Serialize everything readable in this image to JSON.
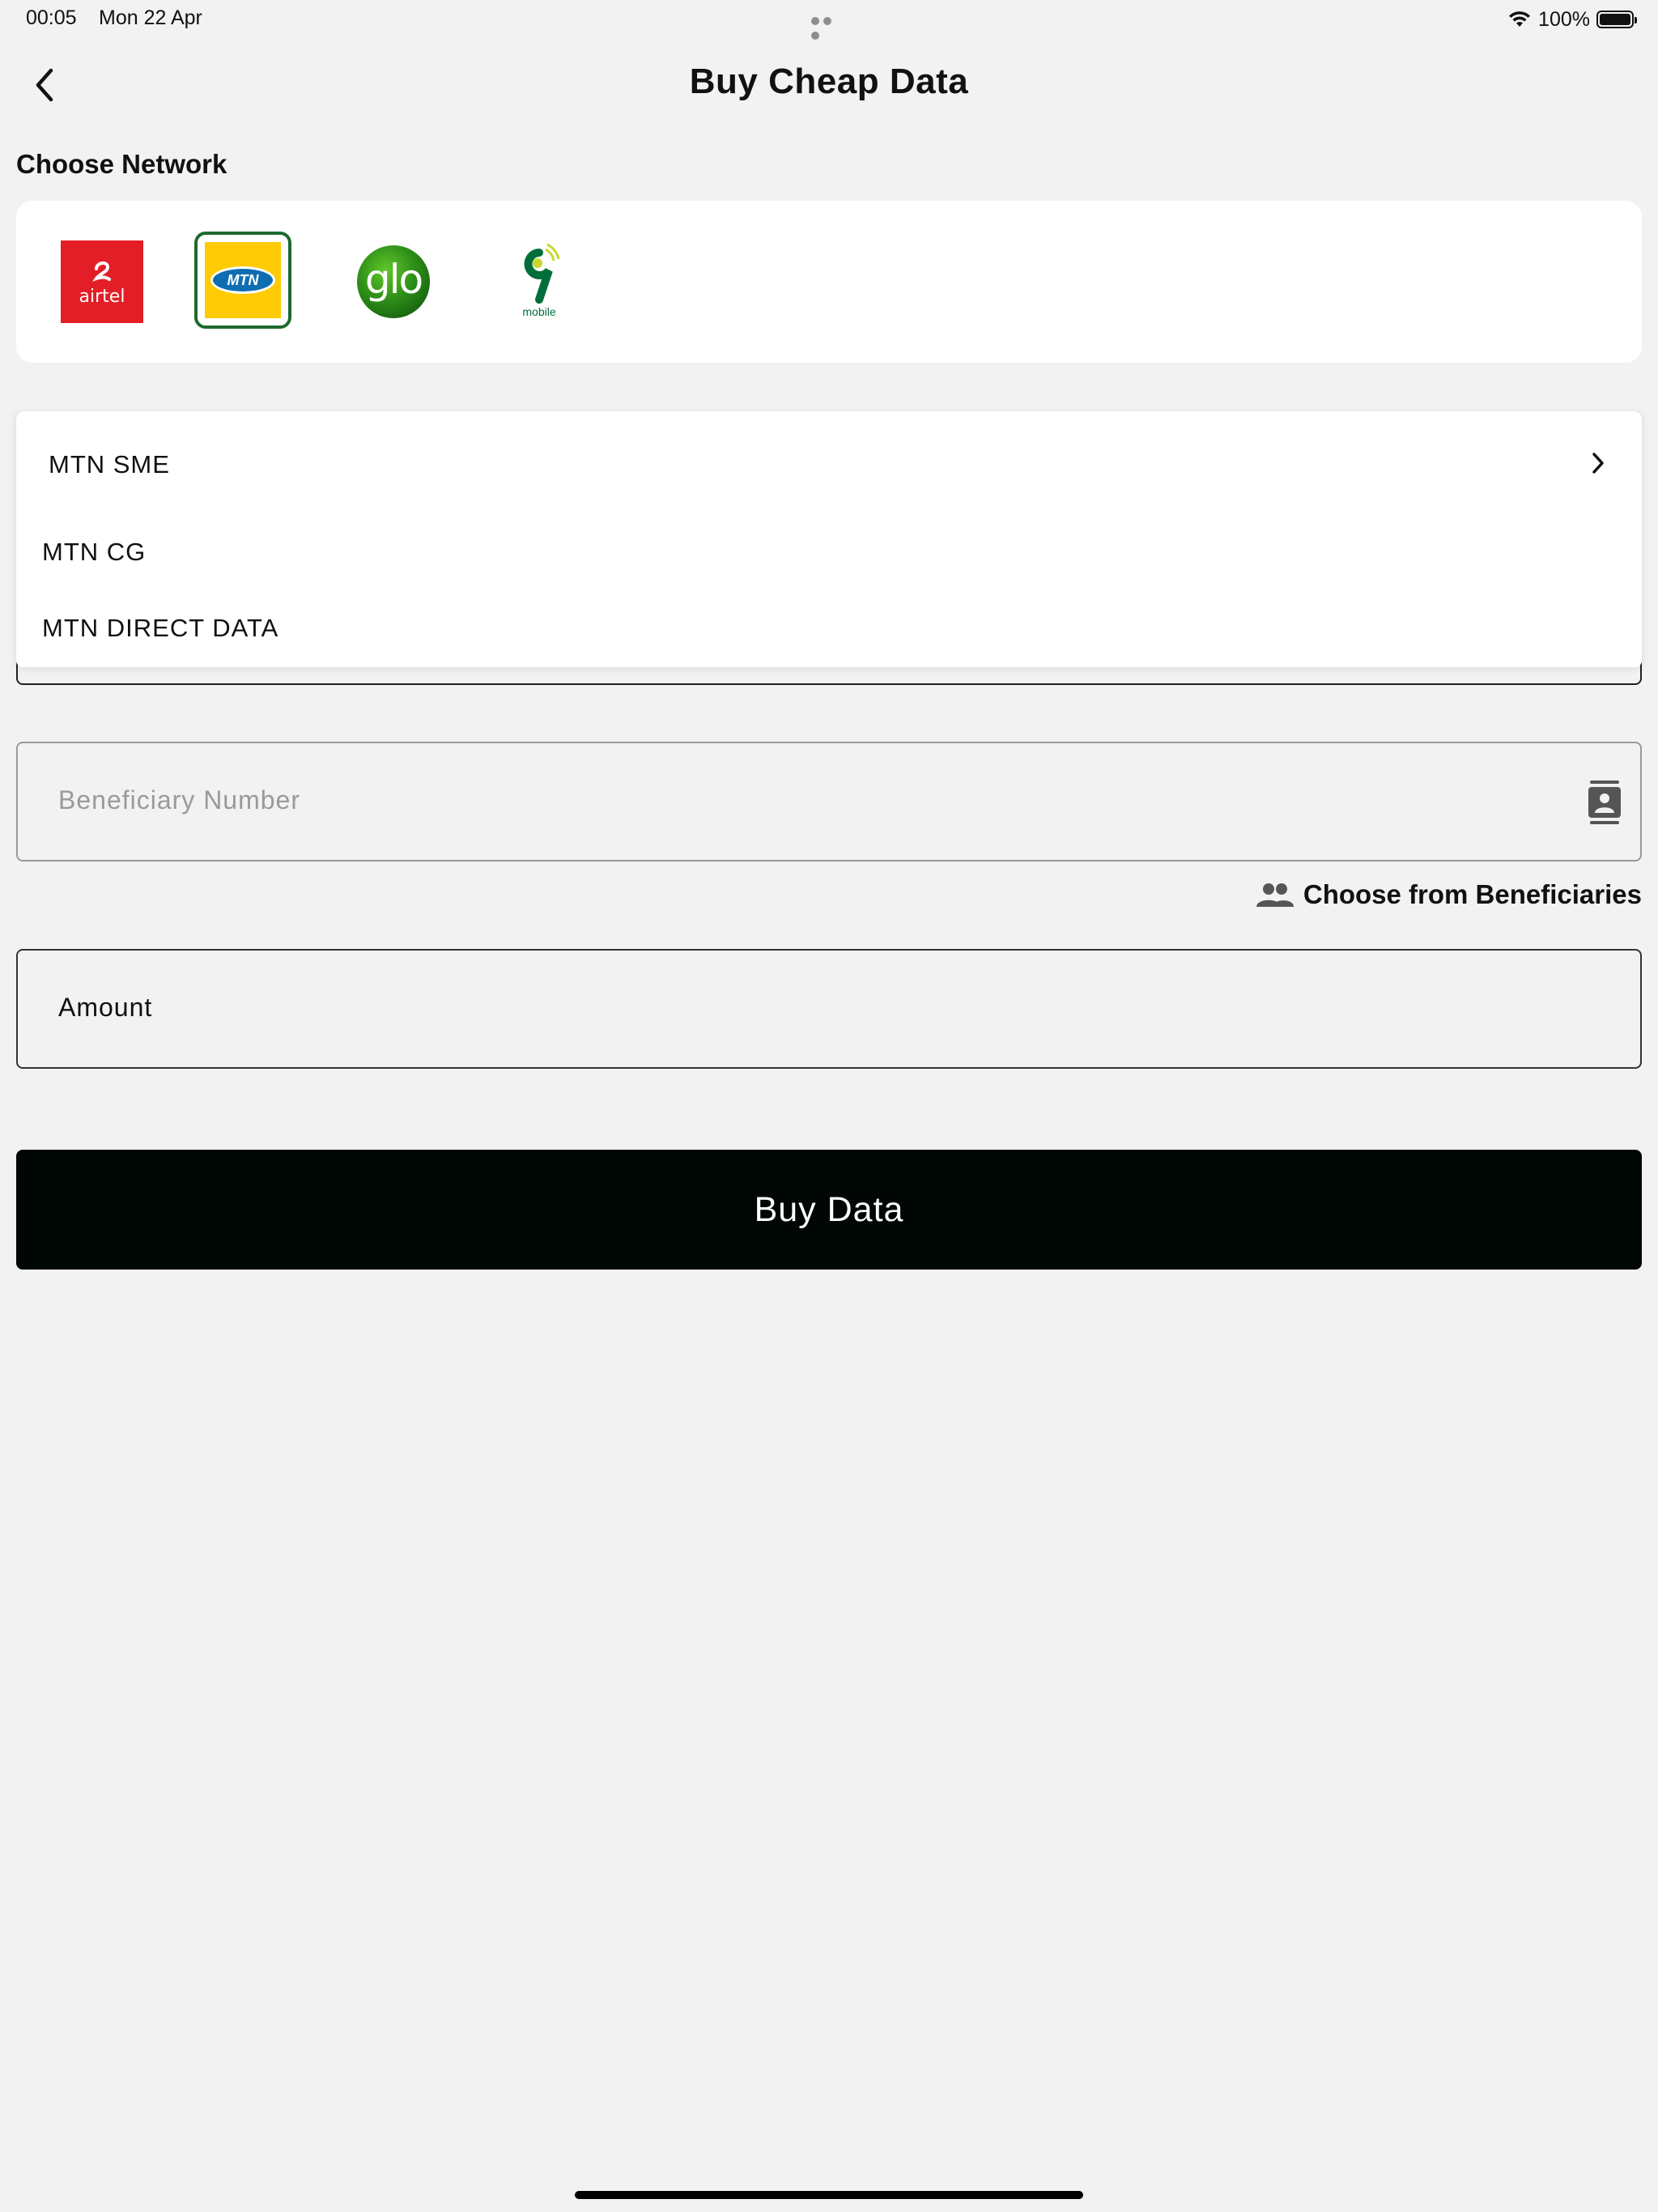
{
  "status_bar": {
    "time": "00:05",
    "date": "Mon 22 Apr",
    "battery": "100%",
    "wifi_icon": "wifi-icon",
    "battery_icon": "battery-icon"
  },
  "header": {
    "title": "Buy Cheap Data",
    "back_icon": "chevron-left-icon"
  },
  "network": {
    "section_label": "Choose Network",
    "options": [
      {
        "name": "airtel",
        "logo_text": "airtel",
        "color": "#e41e26",
        "selected": false
      },
      {
        "name": "mtn",
        "logo_text": "MTN",
        "color": "#ffcb05",
        "selected": true
      },
      {
        "name": "glo",
        "logo_text": "glo",
        "color": "#2d8f18",
        "selected": false
      },
      {
        "name": "9mobile",
        "logo_text": "mobile",
        "color": "#006e3b",
        "selected": false
      }
    ],
    "selected_border_color": "#1e6a2e"
  },
  "plan_dropdown": {
    "items": [
      {
        "label": "MTN SME"
      },
      {
        "label": "MTN CG"
      },
      {
        "label": "MTN DIRECT DATA"
      }
    ]
  },
  "beneficiary": {
    "placeholder": "Beneficiary Number",
    "choose_label": "Choose from Beneficiaries"
  },
  "amount": {
    "label": "Amount"
  },
  "buy_button": {
    "label": "Buy Data",
    "color": "#010705"
  }
}
